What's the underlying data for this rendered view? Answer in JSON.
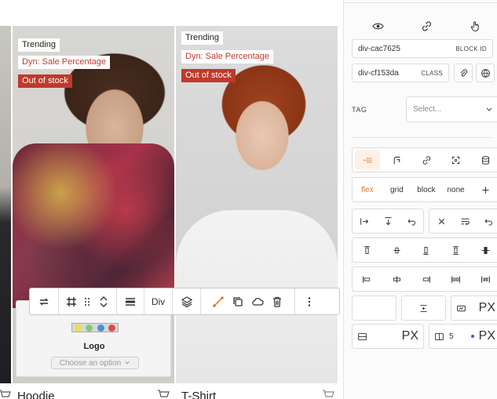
{
  "canvas": {
    "products": [
      {
        "tags": {
          "trending": "Trending",
          "dynamic": "Dyn: Sale Percentage",
          "stock": "Out of stock"
        },
        "name": "Hoodie"
      },
      {
        "tags": {
          "trending": "Trending",
          "dynamic": "Dyn: Sale Percentage",
          "stock": "Out of stock"
        },
        "name": "T-Shirt"
      }
    ],
    "toolbar": {
      "element_label": "Div",
      "icons": [
        "loop-icon",
        "grid-hash-icon",
        "drag-handle-icon",
        "chevron-updown-icon",
        "align-center-icon",
        "layers-icon",
        "connector-icon",
        "duplicate-icon",
        "cloud-icon",
        "trash-icon",
        "more-vertical-icon"
      ]
    },
    "popover": {
      "swatches": [
        "#e8e04a",
        "#7fc97f",
        "#4a90d9",
        "#e04a4a"
      ],
      "label": "Logo",
      "choose_placeholder": "Choose an option"
    }
  },
  "panel": {
    "top_icons": [
      "eye-icon",
      "link-icon",
      "pointer-hand-icon"
    ],
    "block_id": {
      "value": "div-cac7625",
      "suffix": "BLOCK ID"
    },
    "class_field": {
      "value": "div-cf153da",
      "suffix": "CLASS"
    },
    "tag": {
      "label": "TAG",
      "placeholder": "Select..."
    },
    "tabs_icons": [
      "layout-dots-icon",
      "corner-icon",
      "link-icon",
      "resize-icon",
      "database-icon"
    ],
    "display_options": [
      "flex",
      "grid",
      "block",
      "none"
    ],
    "active_display": "flex",
    "gap": {
      "unit_a": "PX",
      "unit_b": "PX",
      "count": "5",
      "unit_c": "PX"
    }
  },
  "colors": {
    "accent": "#e07a2a",
    "danger": "#c0392b"
  }
}
